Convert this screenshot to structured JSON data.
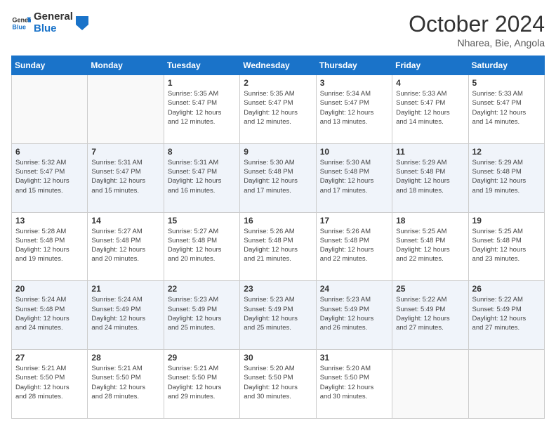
{
  "header": {
    "logo_line1": "General",
    "logo_line2": "Blue",
    "month": "October 2024",
    "location": "Nharea, Bie, Angola"
  },
  "weekdays": [
    "Sunday",
    "Monday",
    "Tuesday",
    "Wednesday",
    "Thursday",
    "Friday",
    "Saturday"
  ],
  "weeks": [
    [
      {
        "day": "",
        "empty": true
      },
      {
        "day": "",
        "empty": true
      },
      {
        "day": "1",
        "sunrise": "5:35 AM",
        "sunset": "5:47 PM",
        "daylight": "12 hours and 12 minutes."
      },
      {
        "day": "2",
        "sunrise": "5:35 AM",
        "sunset": "5:47 PM",
        "daylight": "12 hours and 12 minutes."
      },
      {
        "day": "3",
        "sunrise": "5:34 AM",
        "sunset": "5:47 PM",
        "daylight": "12 hours and 13 minutes."
      },
      {
        "day": "4",
        "sunrise": "5:33 AM",
        "sunset": "5:47 PM",
        "daylight": "12 hours and 14 minutes."
      },
      {
        "day": "5",
        "sunrise": "5:33 AM",
        "sunset": "5:47 PM",
        "daylight": "12 hours and 14 minutes."
      }
    ],
    [
      {
        "day": "6",
        "sunrise": "5:32 AM",
        "sunset": "5:47 PM",
        "daylight": "12 hours and 15 minutes."
      },
      {
        "day": "7",
        "sunrise": "5:31 AM",
        "sunset": "5:47 PM",
        "daylight": "12 hours and 15 minutes."
      },
      {
        "day": "8",
        "sunrise": "5:31 AM",
        "sunset": "5:47 PM",
        "daylight": "12 hours and 16 minutes."
      },
      {
        "day": "9",
        "sunrise": "5:30 AM",
        "sunset": "5:48 PM",
        "daylight": "12 hours and 17 minutes."
      },
      {
        "day": "10",
        "sunrise": "5:30 AM",
        "sunset": "5:48 PM",
        "daylight": "12 hours and 17 minutes."
      },
      {
        "day": "11",
        "sunrise": "5:29 AM",
        "sunset": "5:48 PM",
        "daylight": "12 hours and 18 minutes."
      },
      {
        "day": "12",
        "sunrise": "5:29 AM",
        "sunset": "5:48 PM",
        "daylight": "12 hours and 19 minutes."
      }
    ],
    [
      {
        "day": "13",
        "sunrise": "5:28 AM",
        "sunset": "5:48 PM",
        "daylight": "12 hours and 19 minutes."
      },
      {
        "day": "14",
        "sunrise": "5:27 AM",
        "sunset": "5:48 PM",
        "daylight": "12 hours and 20 minutes."
      },
      {
        "day": "15",
        "sunrise": "5:27 AM",
        "sunset": "5:48 PM",
        "daylight": "12 hours and 20 minutes."
      },
      {
        "day": "16",
        "sunrise": "5:26 AM",
        "sunset": "5:48 PM",
        "daylight": "12 hours and 21 minutes."
      },
      {
        "day": "17",
        "sunrise": "5:26 AM",
        "sunset": "5:48 PM",
        "daylight": "12 hours and 22 minutes."
      },
      {
        "day": "18",
        "sunrise": "5:25 AM",
        "sunset": "5:48 PM",
        "daylight": "12 hours and 22 minutes."
      },
      {
        "day": "19",
        "sunrise": "5:25 AM",
        "sunset": "5:48 PM",
        "daylight": "12 hours and 23 minutes."
      }
    ],
    [
      {
        "day": "20",
        "sunrise": "5:24 AM",
        "sunset": "5:48 PM",
        "daylight": "12 hours and 24 minutes."
      },
      {
        "day": "21",
        "sunrise": "5:24 AM",
        "sunset": "5:49 PM",
        "daylight": "12 hours and 24 minutes."
      },
      {
        "day": "22",
        "sunrise": "5:23 AM",
        "sunset": "5:49 PM",
        "daylight": "12 hours and 25 minutes."
      },
      {
        "day": "23",
        "sunrise": "5:23 AM",
        "sunset": "5:49 PM",
        "daylight": "12 hours and 25 minutes."
      },
      {
        "day": "24",
        "sunrise": "5:23 AM",
        "sunset": "5:49 PM",
        "daylight": "12 hours and 26 minutes."
      },
      {
        "day": "25",
        "sunrise": "5:22 AM",
        "sunset": "5:49 PM",
        "daylight": "12 hours and 27 minutes."
      },
      {
        "day": "26",
        "sunrise": "5:22 AM",
        "sunset": "5:49 PM",
        "daylight": "12 hours and 27 minutes."
      }
    ],
    [
      {
        "day": "27",
        "sunrise": "5:21 AM",
        "sunset": "5:50 PM",
        "daylight": "12 hours and 28 minutes."
      },
      {
        "day": "28",
        "sunrise": "5:21 AM",
        "sunset": "5:50 PM",
        "daylight": "12 hours and 28 minutes."
      },
      {
        "day": "29",
        "sunrise": "5:21 AM",
        "sunset": "5:50 PM",
        "daylight": "12 hours and 29 minutes."
      },
      {
        "day": "30",
        "sunrise": "5:20 AM",
        "sunset": "5:50 PM",
        "daylight": "12 hours and 30 minutes."
      },
      {
        "day": "31",
        "sunrise": "5:20 AM",
        "sunset": "5:50 PM",
        "daylight": "12 hours and 30 minutes."
      },
      {
        "day": "",
        "empty": true
      },
      {
        "day": "",
        "empty": true
      }
    ]
  ],
  "labels": {
    "sunrise": "Sunrise:",
    "sunset": "Sunset:",
    "daylight": "Daylight:"
  }
}
